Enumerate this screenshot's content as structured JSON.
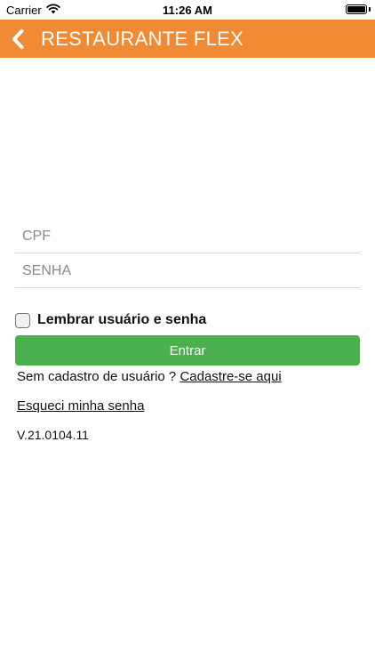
{
  "status_bar": {
    "carrier": "Carrier",
    "time": "11:26 AM"
  },
  "header": {
    "title": "RESTAURANTE FLEX",
    "background_color": "#f08a35"
  },
  "form": {
    "cpf": {
      "value": "",
      "placeholder": "CPF"
    },
    "senha": {
      "value": "",
      "placeholder": "SENHA"
    },
    "remember": {
      "label": "Lembrar usuário e senha",
      "checked": false
    },
    "login_button": {
      "label": "Entrar",
      "color": "#4caf50"
    }
  },
  "links": {
    "signup_prompt": "Sem cadastro de usuário ? ",
    "signup_link": "Cadastre-se aqui",
    "forgot_password": "Esqueci minha senha"
  },
  "version": "V.21.0104.11"
}
